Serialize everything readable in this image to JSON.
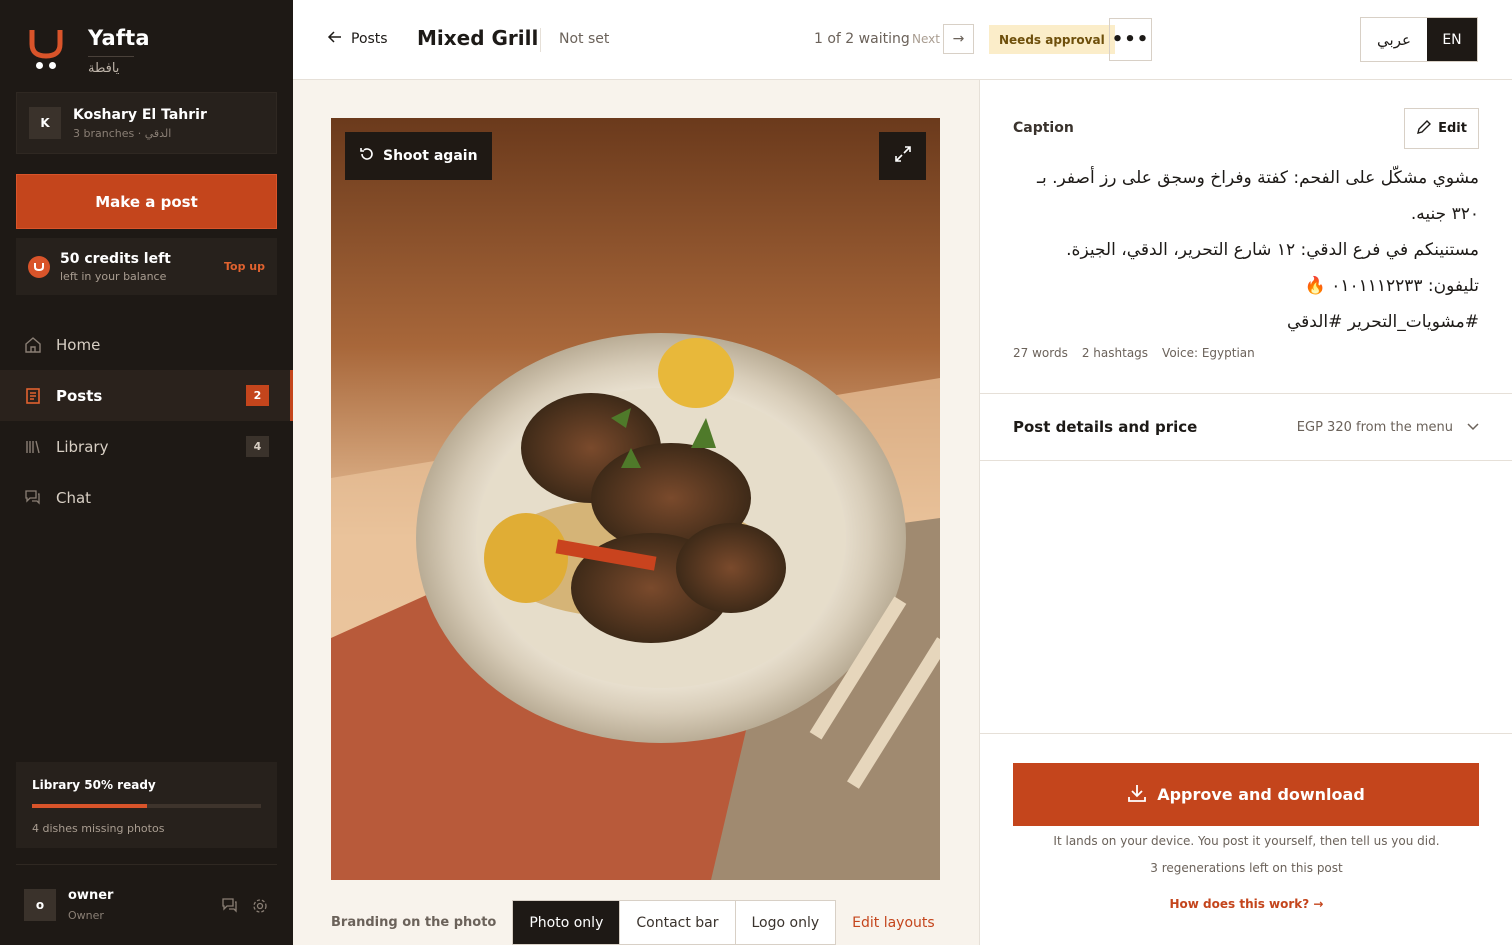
{
  "brand": {
    "name": "Yafta",
    "name_ar": "يافطة"
  },
  "account": {
    "initial": "K",
    "name": "Koshary El Tahrir",
    "sub": "3 branches · الدقي"
  },
  "sidebar": {
    "make_post": "Make a post",
    "credits": {
      "title": "50 credits left",
      "sub": "left in your balance",
      "topup": "Top up"
    },
    "nav": [
      {
        "label": "Home",
        "icon": "home-icon"
      },
      {
        "label": "Posts",
        "icon": "posts-icon",
        "badge": "2",
        "active": true
      },
      {
        "label": "Library",
        "icon": "library-icon",
        "badge": "4"
      },
      {
        "label": "Chat",
        "icon": "chat-icon"
      }
    ],
    "library_status": {
      "title": "Library 50% ready",
      "progress": 0.5,
      "sub": "4 dishes missing photos"
    },
    "user": {
      "initial": "o",
      "name": "owner",
      "role": "Owner"
    }
  },
  "topbar": {
    "back_label": "Posts",
    "title": "Mixed Grill",
    "status": "Not set",
    "waiting": "1 of 2 waiting",
    "next": "Next",
    "badge": "Needs approval",
    "more": "•••",
    "lang_ar": "عربي",
    "lang_en": "EN"
  },
  "photo": {
    "shoot_again": "Shoot again",
    "branding_label": "Branding on the photo",
    "branding_options": [
      "Photo only",
      "Contact bar",
      "Logo only"
    ],
    "branding_selected": "Photo only",
    "edit_layouts": "Edit layouts"
  },
  "caption": {
    "heading": "Caption",
    "edit": "Edit",
    "lines": [
      "مشوي مشكّل على الفحم: كفتة وفراخ وسجق على رز أصفر. بـ ٣٢٠ جنيه.",
      "مستنينكم في فرع الدقي: ١٢ شارع التحرير، الدقي، الجيزة.",
      "تليفون: ٠١٠١١١٢٢٣٣ 🔥",
      "#مشويات_التحرير #الدقي"
    ],
    "meta": {
      "words": "27 words",
      "hashtags": "2 hashtags",
      "voice": "Voice: Egyptian"
    }
  },
  "details": {
    "title": "Post details and price",
    "price": "EGP 320 from the menu"
  },
  "footer": {
    "approve": "Approve and download",
    "note": "It lands on your device. You post it yourself, then tell us you did.",
    "regen": "3 regenerations left on this post",
    "how": "How does this work? →"
  },
  "colors": {
    "accent": "#c4451c",
    "sidebar": "#1e1915",
    "badge_bg": "#fbedc9"
  }
}
